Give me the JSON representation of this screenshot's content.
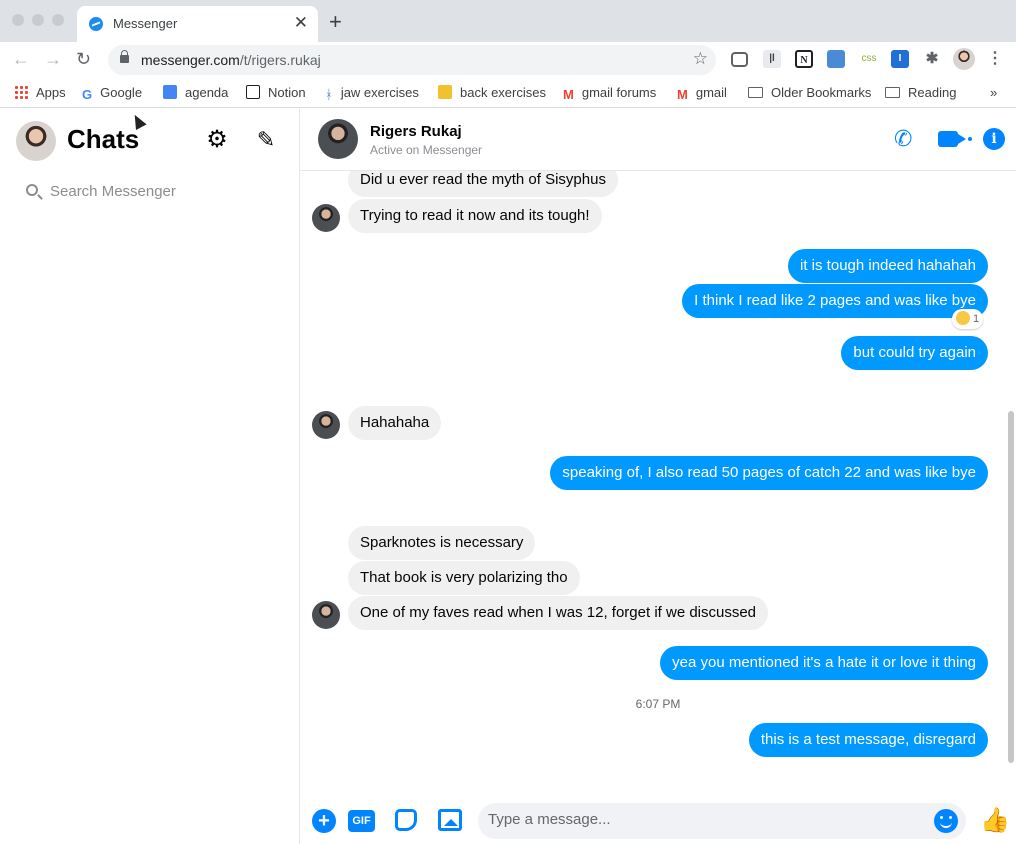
{
  "browser": {
    "tab_title": "Messenger",
    "url_host": "messenger.com",
    "url_path": "/t/rigers.rukaj",
    "bookmarks": [
      {
        "label": "Apps"
      },
      {
        "label": "Google"
      },
      {
        "label": "agenda"
      },
      {
        "label": "Notion"
      },
      {
        "label": "jaw exercises"
      },
      {
        "label": "back exercises"
      },
      {
        "label": "gmail forums"
      },
      {
        "label": "gmail"
      },
      {
        "label": "Older Bookmarks"
      },
      {
        "label": "Reading"
      }
    ],
    "bookmarks_overflow": "»",
    "extensions": {
      "css_label": "css",
      "one_label": "I"
    }
  },
  "sidebar": {
    "title": "Chats",
    "search_placeholder": "Search Messenger"
  },
  "conversation": {
    "contact_name": "Rigers Rukaj",
    "contact_status": "Active on Messenger",
    "messages": [
      {
        "from": "them",
        "text": "Did u ever read the myth of Sisyphus"
      },
      {
        "from": "them",
        "text": "Trying to read it now and its tough!"
      },
      {
        "from": "me",
        "text": "it is tough indeed hahahah"
      },
      {
        "from": "me",
        "text": "I think I read like 2 pages and was like bye"
      },
      {
        "from": "me",
        "text": "but could try again"
      },
      {
        "from": "them",
        "text": "Hahahaha"
      },
      {
        "from": "me",
        "text": "speaking of, I also read 50 pages of catch 22 and was like bye"
      },
      {
        "from": "them",
        "text": "Sparknotes is necessary"
      },
      {
        "from": "them",
        "text": "That book is very polarizing tho"
      },
      {
        "from": "them",
        "text": "One of my faves read when I was 12, forget if we discussed"
      },
      {
        "from": "me",
        "text": "yea you mentioned it's a hate it or love it thing"
      },
      {
        "from": "me",
        "text": "this is a test message, disregard"
      }
    ],
    "reaction_count": "1",
    "timestamp": "6:07 PM"
  },
  "composer": {
    "placeholder": "Type a message...",
    "gif_label": "GIF"
  },
  "colors": {
    "accent": "#0084ff",
    "outgoing_bubble": "#0099ff",
    "incoming_bubble": "#f0f0f0"
  }
}
